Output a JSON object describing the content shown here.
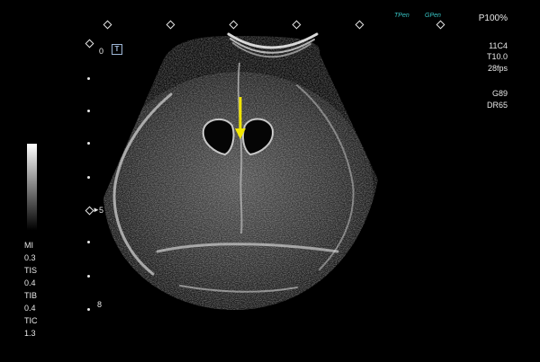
{
  "depth_scale": {
    "top_marker": "0",
    "mid_marker": "5",
    "bottom_marker": "8"
  },
  "probe_icon": "T",
  "top_right_badges": {
    "left": "TPen",
    "right": "GPen"
  },
  "power": "P100%",
  "settings": [
    "11C4",
    "T10.0",
    "28fps",
    "G89",
    "DR65"
  ],
  "acoustic": [
    {
      "label": "MI",
      "value": "0.3"
    },
    {
      "label": "TIS",
      "value": "0.4"
    },
    {
      "label": "TIB",
      "value": "0.4"
    },
    {
      "label": "TIC",
      "value": "1.3"
    }
  ],
  "annotation": {
    "arrow_color": "#f2e600"
  },
  "colors": {
    "background": "#000000",
    "text": "#e8e8e8",
    "preset": "#38c6c6"
  }
}
